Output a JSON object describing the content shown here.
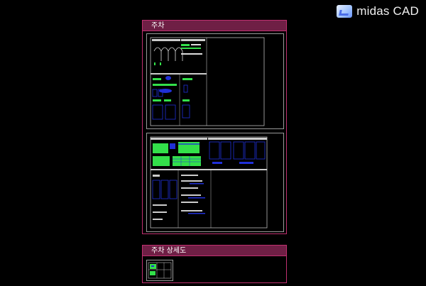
{
  "brand": {
    "name": "midas CAD",
    "icon": "midas-logo-icon"
  },
  "sections": [
    {
      "title": "주차"
    },
    {
      "title": "주차 상세도"
    }
  ],
  "colors": {
    "accent": "#c03070",
    "title_bar": "#6f1f45",
    "frame": "#9a9a9a",
    "cad_green": "#33e04a",
    "cad_blue": "#2030d8"
  }
}
